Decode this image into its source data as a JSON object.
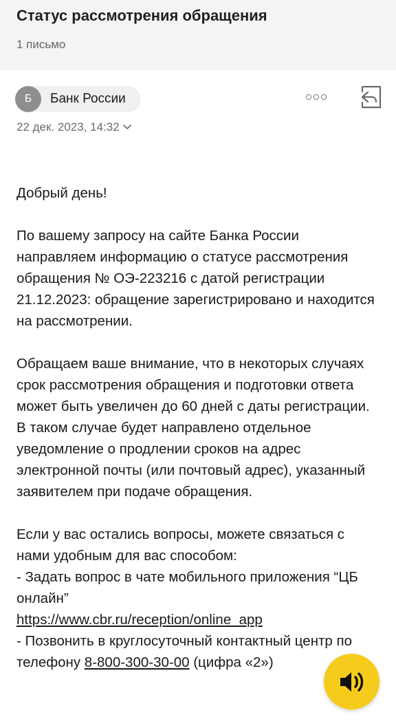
{
  "header": {
    "subject": "Статус рассмотрения обращения",
    "count": "1 письмо"
  },
  "sender": {
    "initial": "Б",
    "name": "Банк России"
  },
  "date": "22 дек. 2023, 14:32",
  "icons": {
    "more": "more-icon",
    "reply": "reply-icon",
    "date_expand": "chevron-down-icon",
    "audio": "speaker-icon"
  },
  "colors": {
    "header_bg": "#f4f4f4",
    "avatar_bg": "#8e8e8e",
    "fab_bg": "#f6cc1c"
  },
  "body": {
    "greeting": "Добрый день!",
    "para1": "По вашему запросу на сайте Банка России направляем информацию о статусе рассмотрения обращения № ОЭ-223216 с датой регистрации 21.12.2023: обращение зарегистрировано и находится на рассмотрении.",
    "para2": "Обращаем ваше внимание, что в некоторых случаях срок рассмотрения обращения и подготовки ответа может быть увеличен до 60 дней с даты регистрации. В таком случае будет направлено отдельное уведомление о продлении сроков на адрес электронной почты (или почтовый адрес), указанный заявителем при подаче обращения.",
    "para3_intro": "Если у вас остались вопросы, можете связаться с нами удобным для вас способом:",
    "item1": "- Задать вопрос в чате мобильного приложения “ЦБ онлайн”",
    "link1": "https://www.cbr.ru/reception/online_app",
    "item2_prefix": "- Позвонить в круглосуточный контактный центр по телефону",
    "phone": "8-800-300-30-00",
    "item2_suffix": "(цифра «2»)"
  }
}
